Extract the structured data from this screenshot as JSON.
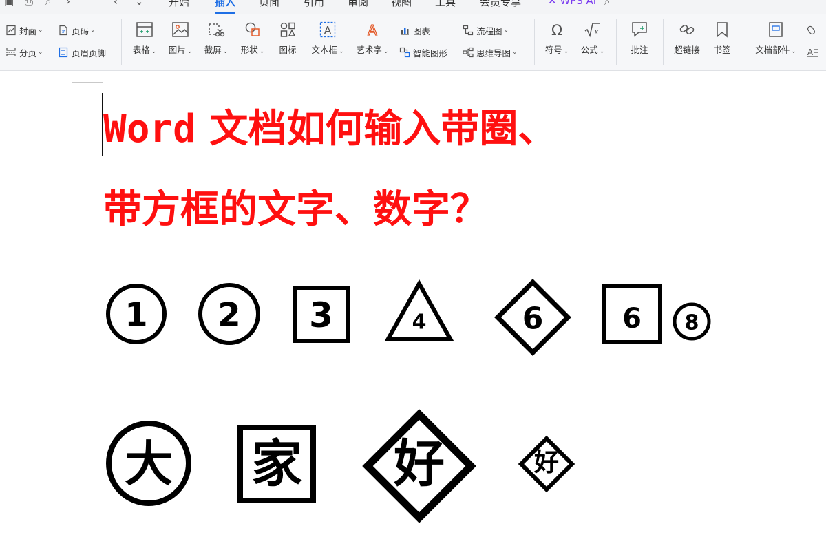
{
  "tabs": [
    {
      "label": "开始",
      "active": false
    },
    {
      "label": "插入",
      "active": true
    },
    {
      "label": "页面",
      "active": false
    },
    {
      "label": "引用",
      "active": false
    },
    {
      "label": "审阅",
      "active": false
    },
    {
      "label": "视图",
      "active": false
    },
    {
      "label": "工具",
      "active": false
    },
    {
      "label": "会员专享",
      "active": false
    },
    {
      "label": "WPS AI",
      "active": false
    }
  ],
  "ribbon": {
    "cover": "封面",
    "page_number": "页码",
    "page_break": "分页",
    "header_footer": "页眉页脚",
    "table": "表格",
    "picture": "图片",
    "screenshot": "截屏",
    "shape": "形状",
    "icon": "图标",
    "textbox": "文本框",
    "wordart": "艺术字",
    "chart": "图表",
    "smart_graphic": "智能图形",
    "flowchart": "流程图",
    "mindmap": "思维导图",
    "symbol": "符号",
    "formula": "公式",
    "comment": "批注",
    "hyperlink": "超链接",
    "bookmark": "书签",
    "doc_parts": "文档部件"
  },
  "document": {
    "title_latin": "Word",
    "title_line1": " 文档如何输入带圈、",
    "title_line2": "带方框的文字、数字？",
    "symbols_row1": [
      {
        "shape": "circle",
        "char": "1"
      },
      {
        "shape": "circle",
        "char": "2"
      },
      {
        "shape": "square",
        "char": "3"
      },
      {
        "shape": "triangle",
        "char": "4"
      },
      {
        "shape": "diamond",
        "char": "6"
      },
      {
        "shape": "square",
        "char": "6"
      },
      {
        "shape": "circle",
        "char": "8"
      }
    ],
    "symbols_row2": [
      {
        "shape": "circle",
        "char": "大"
      },
      {
        "shape": "square",
        "char": "家"
      },
      {
        "shape": "diamond",
        "char": "好"
      },
      {
        "shape": "diamond",
        "char": "好"
      }
    ]
  },
  "colors": {
    "title": "#ff1010",
    "accent": "#1f6fe5"
  }
}
